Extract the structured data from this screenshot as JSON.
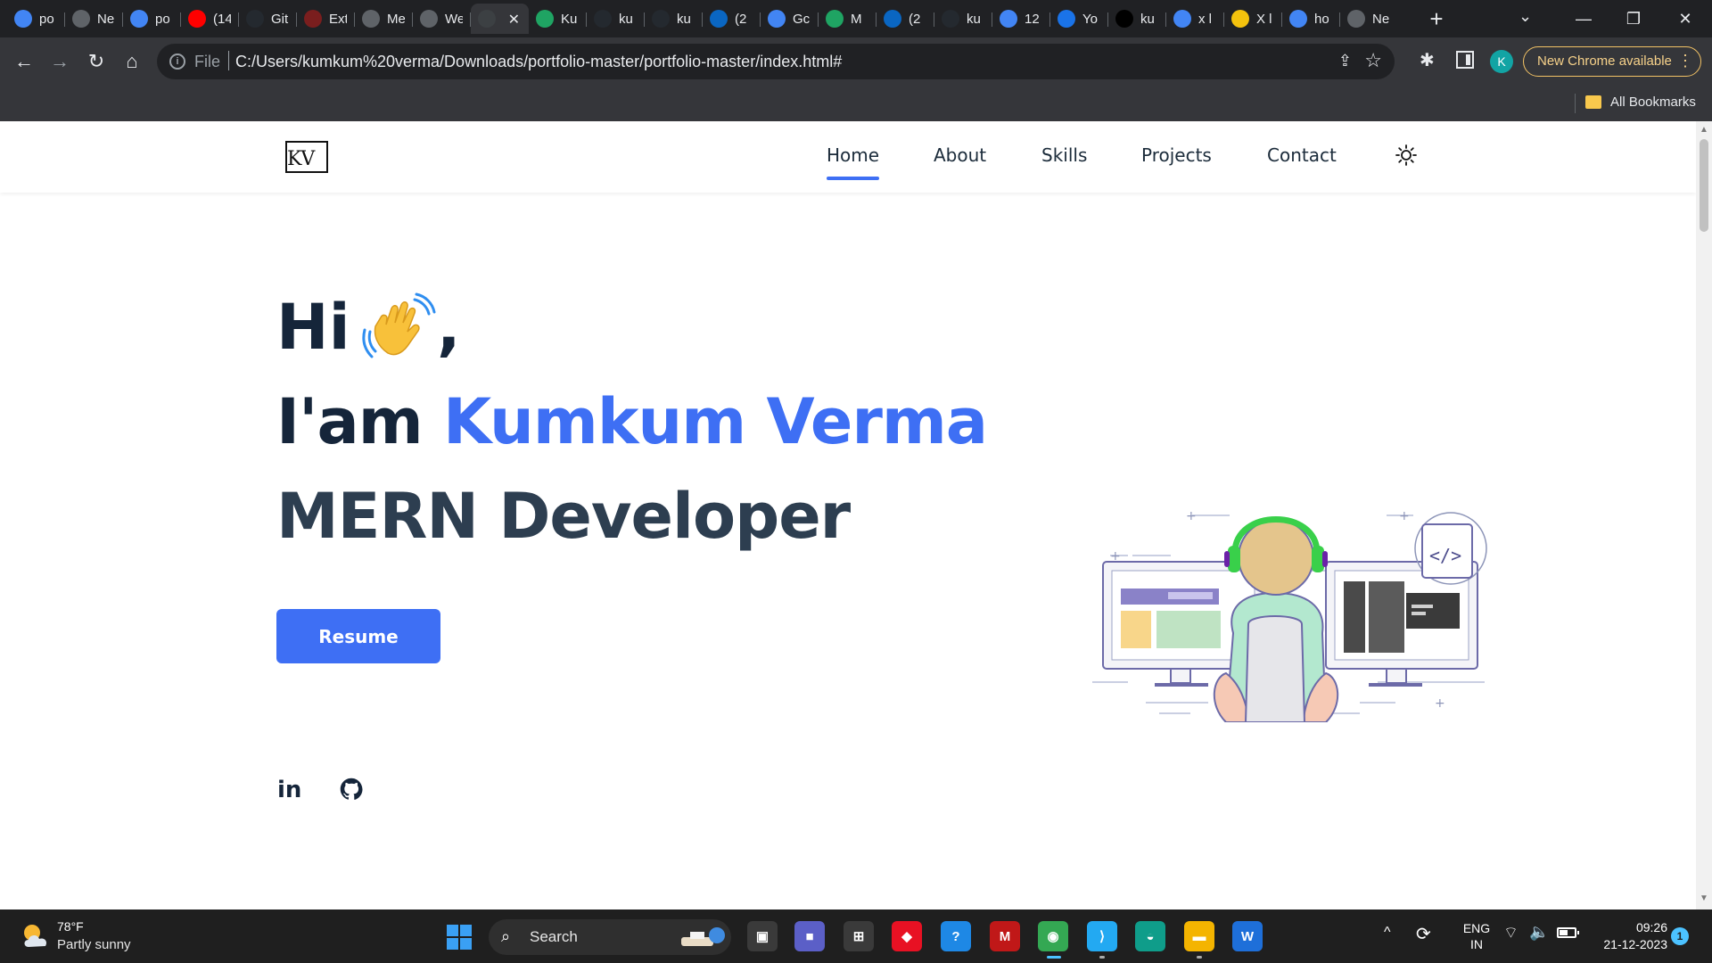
{
  "browser": {
    "tabs": [
      {
        "favicon": "google-g-icon",
        "title": "po",
        "color": "#4285f4"
      },
      {
        "favicon": "chrome-icon",
        "title": "Ne",
        "color": "#5f6368"
      },
      {
        "favicon": "google-g-icon",
        "title": "po",
        "color": "#4285f4"
      },
      {
        "favicon": "youtube-icon",
        "title": "(14",
        "color": "#ff0000"
      },
      {
        "favicon": "github-icon",
        "title": "Git",
        "color": "#24292f"
      },
      {
        "favicon": "extension-page-icon",
        "title": "Ext",
        "color": "#7a1e1e"
      },
      {
        "favicon": "chrome-icon",
        "title": "Me",
        "color": "#5f6368"
      },
      {
        "favicon": "chrome-icon",
        "title": "We",
        "color": "#5f6368"
      },
      {
        "favicon": "globe-icon",
        "title": "",
        "color": "#3c4043",
        "active": true
      },
      {
        "favicon": "google-drive-icon",
        "title": "Ku",
        "color": "#1fa463"
      },
      {
        "favicon": "github-icon",
        "title": "ku",
        "color": "#24292f"
      },
      {
        "favicon": "github-icon",
        "title": "ku",
        "color": "#24292f"
      },
      {
        "favicon": "linkedin-icon",
        "title": "(2",
        "color": "#0a66c2"
      },
      {
        "favicon": "google-g-icon",
        "title": "Gc",
        "color": "#4285f4"
      },
      {
        "favicon": "google-drive-icon",
        "title": "M",
        "color": "#1fa463"
      },
      {
        "favicon": "linkedin-icon",
        "title": "(2",
        "color": "#0a66c2"
      },
      {
        "favicon": "github-icon",
        "title": "ku",
        "color": "#24292f"
      },
      {
        "favicon": "google-g-icon",
        "title": "12",
        "color": "#4285f4"
      },
      {
        "favicon": "apps-icon",
        "title": "Yo",
        "color": "#1a73e8"
      },
      {
        "favicon": "x-icon",
        "title": "ku",
        "color": "#000000"
      },
      {
        "favicon": "google-g-icon",
        "title": "x l",
        "color": "#4285f4"
      },
      {
        "favicon": "emoji-icon",
        "title": "X l",
        "color": "#f4c20d"
      },
      {
        "favicon": "google-g-icon",
        "title": "ho",
        "color": "#4285f4"
      },
      {
        "favicon": "chrome-icon",
        "title": "Ne",
        "color": "#5f6368"
      }
    ],
    "active_tab_close": "✕",
    "new_tab": "+",
    "tab_search": "⌄",
    "window_controls": {
      "minimize": "—",
      "restore": "❐",
      "close": "✕"
    },
    "nav": {
      "back": "←",
      "forward": "→",
      "reload": "↻",
      "home": "⌂"
    },
    "address": {
      "info": "i",
      "scheme": "File",
      "url": "C:/Users/kumkum%20verma/Downloads/portfolio-master/portfolio-master/index.html#"
    },
    "share": "⇪",
    "star": "☆",
    "extensions": "✱",
    "profile_initial": "K",
    "update_chip": "New Chrome available",
    "update_menu": "⋮",
    "bookmarks_label": "All Bookmarks"
  },
  "site": {
    "logo": "KV",
    "nav": [
      "Home",
      "About",
      "Skills",
      "Projects",
      "Contact"
    ],
    "active_nav": "Home",
    "hero": {
      "greeting": "Hi",
      "comma": ",",
      "intro": "I'am",
      "name": "Kumkum Verma",
      "role": "MERN Developer",
      "resume_button": "Resume"
    },
    "social": {
      "linkedin": "in"
    },
    "accent_color": "#3e6ff4",
    "text_color": "#15253a"
  },
  "taskbar": {
    "weather": {
      "temp": "78°F",
      "desc": "Partly sunny"
    },
    "search_label": "Search",
    "search_icon": "⌕",
    "apps": [
      {
        "name": "task-view-icon",
        "glyph": "▣",
        "color": "#3a3a3a"
      },
      {
        "name": "teams-meet-icon",
        "glyph": "■",
        "color": "#5b5fc7"
      },
      {
        "name": "microsoft-store-icon",
        "glyph": "⊞",
        "color": "#3a3a3a"
      },
      {
        "name": "red-app-icon",
        "glyph": "◆",
        "color": "#e81123"
      },
      {
        "name": "help-icon",
        "glyph": "?",
        "color": "#1e88e5"
      },
      {
        "name": "mcafee-icon",
        "glyph": "M",
        "color": "#c01818"
      },
      {
        "name": "chrome-taskbar-icon",
        "glyph": "◉",
        "color": "#34a853",
        "active": true
      },
      {
        "name": "vscode-icon",
        "glyph": "⟩",
        "color": "#23a9f2",
        "open": true
      },
      {
        "name": "edge-icon",
        "glyph": "◒",
        "color": "#0f9d8a"
      },
      {
        "name": "file-explorer-icon",
        "glyph": "▬",
        "color": "#f4b400",
        "open": true
      },
      {
        "name": "blue-app-icon",
        "glyph": "W",
        "color": "#1e6fd9"
      }
    ],
    "tray": {
      "chevron": "^",
      "sync": "⟳",
      "lang_top": "ENG",
      "lang_bottom": "IN",
      "wifi": "⌔",
      "volume": "🔈",
      "time": "09:26",
      "date": "21-12-2023",
      "notifications": "1"
    }
  }
}
